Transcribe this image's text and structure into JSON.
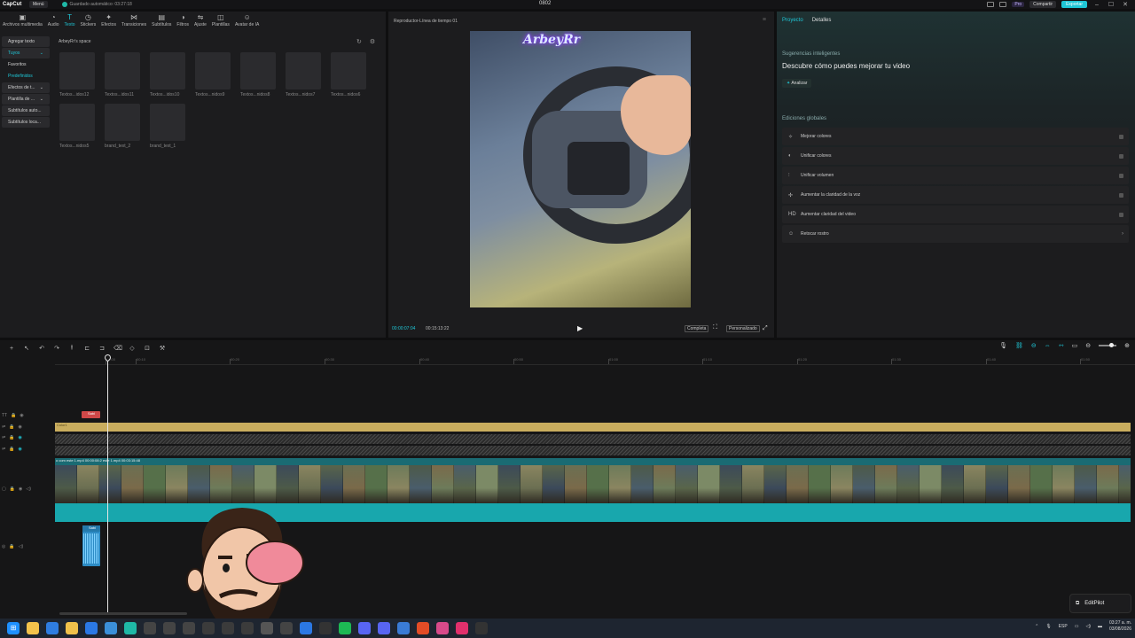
{
  "titlebar": {
    "logo": "CapCut",
    "menu": "Menú",
    "autosave": "Guardado automático: 03:27:18",
    "project_name": "0802",
    "pro": "Pro",
    "share": "Compartir",
    "export": "Exportar"
  },
  "toolbar": {
    "items": [
      {
        "label": "Archivos multimedia",
        "icon": "media-icon"
      },
      {
        "label": "Audio",
        "icon": "audio-icon"
      },
      {
        "label": "Texto",
        "icon": "text-icon"
      },
      {
        "label": "Stickers",
        "icon": "stickers-icon"
      },
      {
        "label": "Efectos",
        "icon": "effects-icon"
      },
      {
        "label": "Transiciones",
        "icon": "transitions-icon"
      },
      {
        "label": "Subtítulos",
        "icon": "subtitles-icon"
      },
      {
        "label": "Filtros",
        "icon": "filters-icon"
      },
      {
        "label": "Ajuste",
        "icon": "adjust-icon"
      },
      {
        "label": "Plantillas",
        "icon": "templates-icon"
      },
      {
        "label": "Avatar de IA",
        "icon": "avatar-icon"
      }
    ]
  },
  "categories": [
    {
      "label": "Agregar texto"
    },
    {
      "label": "Tuyos"
    },
    {
      "label": "Favoritos"
    },
    {
      "label": "Predefinidos"
    },
    {
      "label": "Efectos de t..."
    },
    {
      "label": "Plantilla de ..."
    },
    {
      "label": "Subtítulos auto..."
    },
    {
      "label": "Subtítulos loca..."
    }
  ],
  "space_title": "ArbeyRr's space",
  "cards": [
    "Textos...idos12",
    "Textos...idos11",
    "Textos...idos10",
    "Textos...nidos9",
    "Textos...nidos8",
    "Textos...nidos7",
    "Textos...nidos6",
    "Textos...nidos5",
    "brand_text_2",
    "brand_text_1"
  ],
  "player": {
    "title": "Reproductor-Línea de tiempo 01",
    "logo_text": "ArbeyRr",
    "current_time": "00:00:07:04",
    "total_time": "00:15:13:22",
    "btn_full": "Completa",
    "btn_custom": "Personalizado"
  },
  "right_panel": {
    "tab_project": "Proyecto",
    "tab_details": "Detalles",
    "smart_title": "Sugerencias inteligentes",
    "headline": "Descubre cómo puedes mejorar tu video",
    "analyze": "Analizar",
    "global_title": "Ediciones globales",
    "features": [
      {
        "label": "Mejorar colores",
        "icon": "magic-icon"
      },
      {
        "label": "Unificar colores",
        "icon": "palette-icon"
      },
      {
        "label": "Unificar volumen",
        "icon": "equalizer-icon"
      },
      {
        "label": "Aumentar la claridad de la voz",
        "icon": "voice-icon"
      },
      {
        "label": "Aumentar claridad del video",
        "icon": "hd-icon"
      },
      {
        "label": "Retocar rostro",
        "icon": "face-icon"
      }
    ]
  },
  "timeline": {
    "ticks": [
      "00:00",
      "00:10",
      "00:20",
      "00:30",
      "00:40",
      "00:50",
      "01:00",
      "01:10",
      "01:20",
      "01:30",
      "01:40",
      "01:50"
    ],
    "title_clip": "Sabi",
    "yellow_clip": "Color1",
    "video_header": "o com   este 1.mp4   00:00:08:2   este 1.mp4   00:03:15:48",
    "audio_clip": "Sabi"
  },
  "editpilot": "EditPilot",
  "taskbar": {
    "lang": "ESP",
    "time": "03:27 a. m.",
    "date": "03/08/2026"
  }
}
